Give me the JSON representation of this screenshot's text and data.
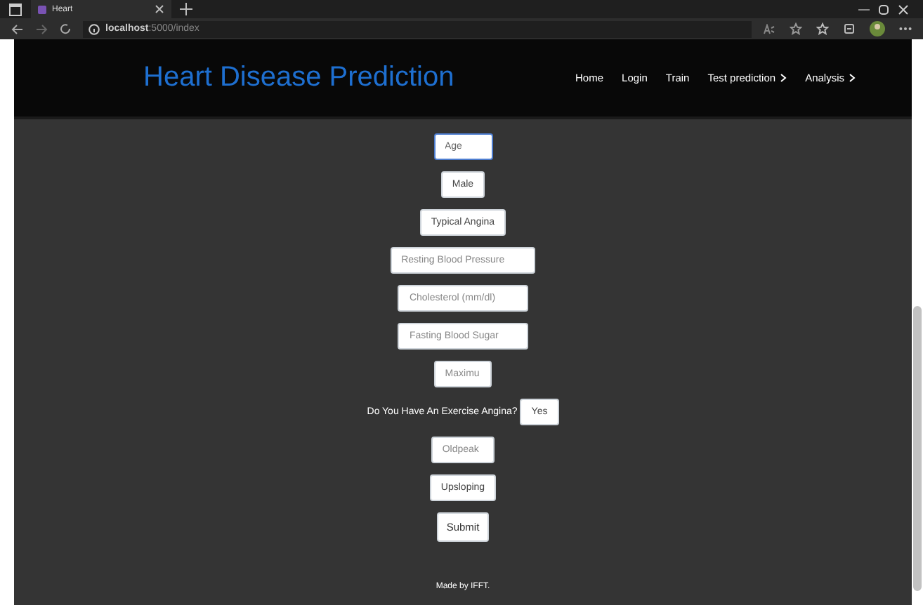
{
  "browser": {
    "tab_title": "Heart",
    "url_host": "localhost",
    "url_path": ":5000/index"
  },
  "navbar": {
    "brand": "Heart Disease Prediction",
    "links": [
      {
        "label": "Home",
        "dropdown": false
      },
      {
        "label": "Login",
        "dropdown": false
      },
      {
        "label": "Train",
        "dropdown": false
      },
      {
        "label": "Test prediction",
        "dropdown": true
      },
      {
        "label": "Analysis",
        "dropdown": true
      }
    ]
  },
  "form": {
    "fields": [
      {
        "kind": "number",
        "placeholder": "Age",
        "focused": true
      },
      {
        "kind": "select",
        "value": "Male"
      },
      {
        "kind": "select",
        "value": "Typical Angina"
      },
      {
        "kind": "text",
        "placeholder": "Resting Blood Pressure"
      },
      {
        "kind": "text",
        "placeholder": "Cholesterol (mm/dl)"
      },
      {
        "kind": "text",
        "placeholder": "Fasting Blood Sugar"
      },
      {
        "kind": "text",
        "placeholder": "Maximu"
      },
      {
        "kind": "select",
        "label": "Do You Have An Exercise Angina?",
        "value": "Yes"
      },
      {
        "kind": "text",
        "placeholder": "Oldpeak"
      },
      {
        "kind": "select",
        "value": "Upsloping"
      }
    ],
    "submit": "Submit"
  },
  "footer": "Made by IFFT."
}
